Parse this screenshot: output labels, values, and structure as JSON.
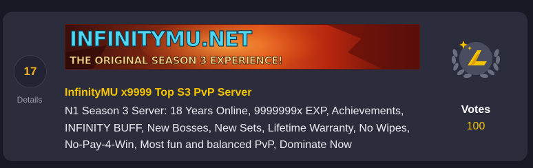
{
  "server": {
    "rank": "17",
    "details_label": "Details",
    "title": "InfinityMU x9999 Top S3 PvP Server",
    "description_lines": [
      "N1 Season 3 Server: 18 Years Online, 9999999x EXP, Achievements,",
      "INFINITY BUFF, New Bosses, New Sets, Lifetime Warranty, No Wipes,",
      "No-Pay-4-Win, Most fun and balanced PvP, Dominate Now"
    ],
    "banner": {
      "logo_text": "INFINITYMU.NET",
      "tagline": "THE ORIGINAL SEASON 3 EXPERIENCE!"
    },
    "votes_label": "Votes",
    "votes_count": "100"
  },
  "icons": {
    "rank_badge": "laurel-badge-icon"
  },
  "colors": {
    "accent": "#f5c400",
    "card_bg": "#2b2d3d",
    "page_bg": "#181925"
  }
}
